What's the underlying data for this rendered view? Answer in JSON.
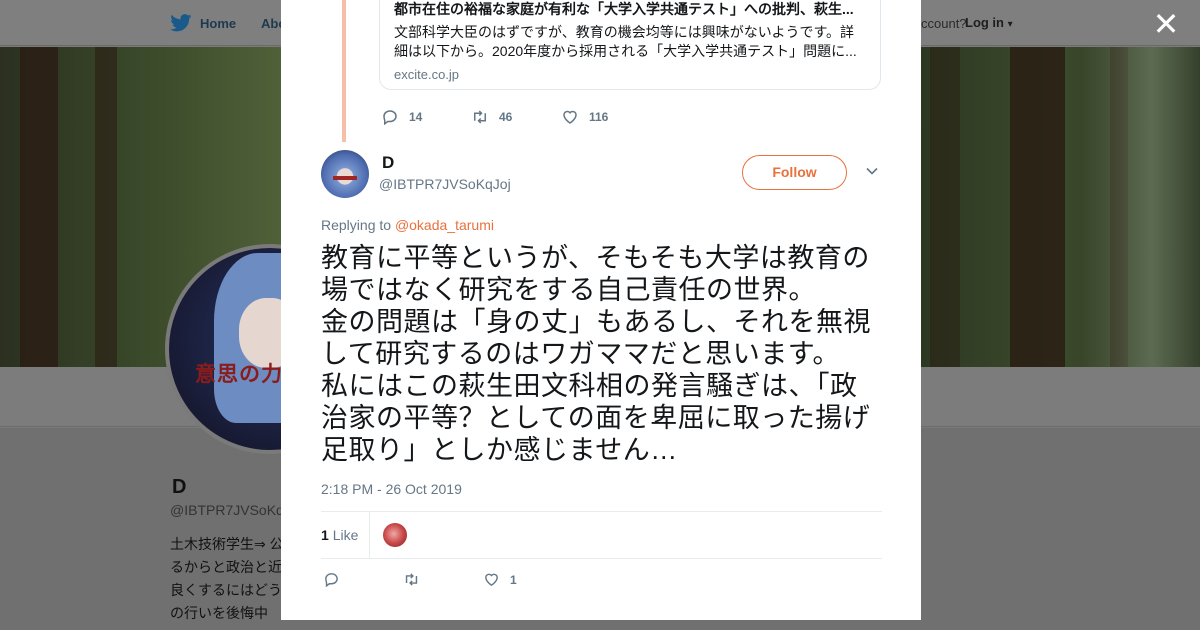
{
  "colors": {
    "accent": "#e8713d",
    "muted": "#657786",
    "text": "#14171a",
    "overlay": "#7a7a7a"
  },
  "nav": {
    "home_label": "Home",
    "about_label": "Abo",
    "account_prompt": "ccount?",
    "login_label": "Log in"
  },
  "background_profile": {
    "avatar_text": "意思の力",
    "name": "D",
    "handle": "@IBTPR7JVSoKq",
    "bio": "土木技術学生⇒ 公\nるからと政治と近\n良くするにはどう\nの行いを後悔中"
  },
  "close_label": "✕",
  "quoted_card": {
    "title": "都市在住の裕福な家庭が有利な「大学入学共通テスト」への批判、萩生...",
    "description": "文部科学大臣のはずですが、教育の機会均等には興味がないようです。詳細は以下から。2020年度から採用される「大学入学共通テスト」問題に...",
    "domain": "excite.co.jp"
  },
  "previous_tweet_actions": {
    "replies": "14",
    "retweets": "46",
    "likes": "116"
  },
  "tweet": {
    "author_name": "D",
    "author_handle": "@IBTPR7JVSoKqJoj",
    "follow_label": "Follow",
    "replying_prefix": "Replying to",
    "replying_handle": "@okada_tarumi",
    "text": "教育に平等というが、そもそも大学は教育の\n場ではなく研究をする自己責任の世界。\n金の問題は「身の丈」もあるし、それを無視\nして研究するのはワガママだと思います。\n私にはこの萩生田文科相の発言騒ぎは、「政\n治家の平等？としての面を卑屈に取った揚げ\n足取り」としか感じません…",
    "timestamp": "2:18 PM - 26 Oct 2019",
    "likes_count": "1",
    "likes_label": "Like",
    "footer_likes": "1"
  },
  "icons": [
    "twitter-bird-icon",
    "caret-down-icon",
    "close-icon",
    "reply-icon",
    "retweet-icon",
    "heart-icon",
    "chevron-down-icon"
  ]
}
